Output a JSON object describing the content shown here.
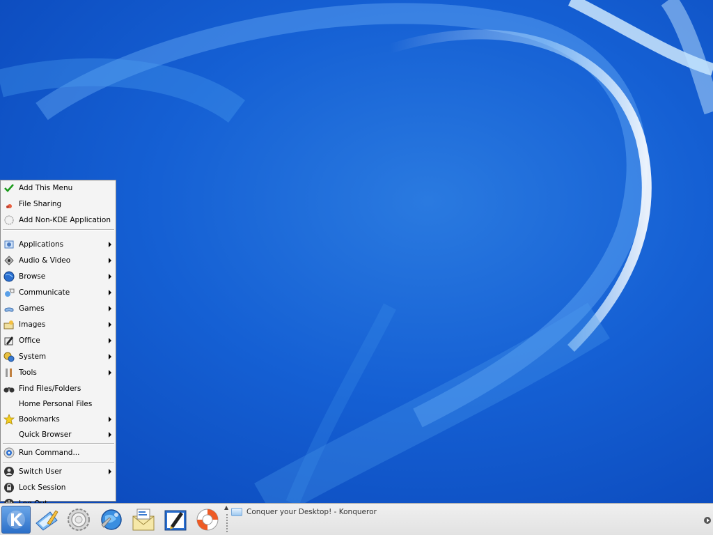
{
  "menu": {
    "top_items": [
      {
        "label": "Add This Menu",
        "icon": "checkmark-icon"
      },
      {
        "label": "File Sharing",
        "icon": "file-sharing-icon"
      },
      {
        "label": "Add Non-KDE Application",
        "icon": "gear-outline-icon"
      }
    ],
    "categories": [
      {
        "label": "Applications",
        "icon": "applications-icon",
        "submenu": true
      },
      {
        "label": "Audio & Video",
        "icon": "audio-video-icon",
        "submenu": true
      },
      {
        "label": "Browse",
        "icon": "globe-icon",
        "submenu": true
      },
      {
        "label": "Communicate",
        "icon": "communicate-icon",
        "submenu": true
      },
      {
        "label": "Games",
        "icon": "gamepad-icon",
        "submenu": true
      },
      {
        "label": "Images",
        "icon": "images-icon",
        "submenu": true
      },
      {
        "label": "Office",
        "icon": "office-icon",
        "submenu": true
      },
      {
        "label": "System",
        "icon": "system-icon",
        "submenu": true
      },
      {
        "label": "Tools",
        "icon": "tools-icon",
        "submenu": true
      },
      {
        "label": "Find Files/Folders",
        "icon": "binoculars-icon",
        "submenu": false
      },
      {
        "label": "Home Personal Files",
        "icon": "home-icon",
        "submenu": false
      },
      {
        "label": "Bookmarks",
        "icon": "star-icon",
        "submenu": true
      },
      {
        "label": "Quick Browser",
        "icon": "quick-browser-icon",
        "submenu": true
      }
    ],
    "run_command": {
      "label": "Run Command...",
      "icon": "run-command-icon"
    },
    "session_items": [
      {
        "label": "Switch User",
        "icon": "switch-user-icon",
        "submenu": true
      },
      {
        "label": "Lock Session",
        "icon": "lock-icon",
        "submenu": false
      },
      {
        "label": "Log Out...",
        "icon": "power-icon",
        "submenu": false
      }
    ]
  },
  "taskbar": {
    "quick_launch": [
      {
        "icon": "kde-k-icon"
      },
      {
        "icon": "kate-editor-icon"
      },
      {
        "icon": "control-center-gear-icon"
      },
      {
        "icon": "konqueror-globe-icon"
      },
      {
        "icon": "kmail-icon"
      },
      {
        "icon": "kword-pen-icon"
      },
      {
        "icon": "help-lifebuoy-icon"
      }
    ],
    "task_title": "Conquer your Desktop! - Konqueror"
  },
  "colors": {
    "desktop_blue": "#1560d4",
    "menu_bg": "#f4f4f4",
    "taskbar_bg": "#e6e6e6"
  }
}
